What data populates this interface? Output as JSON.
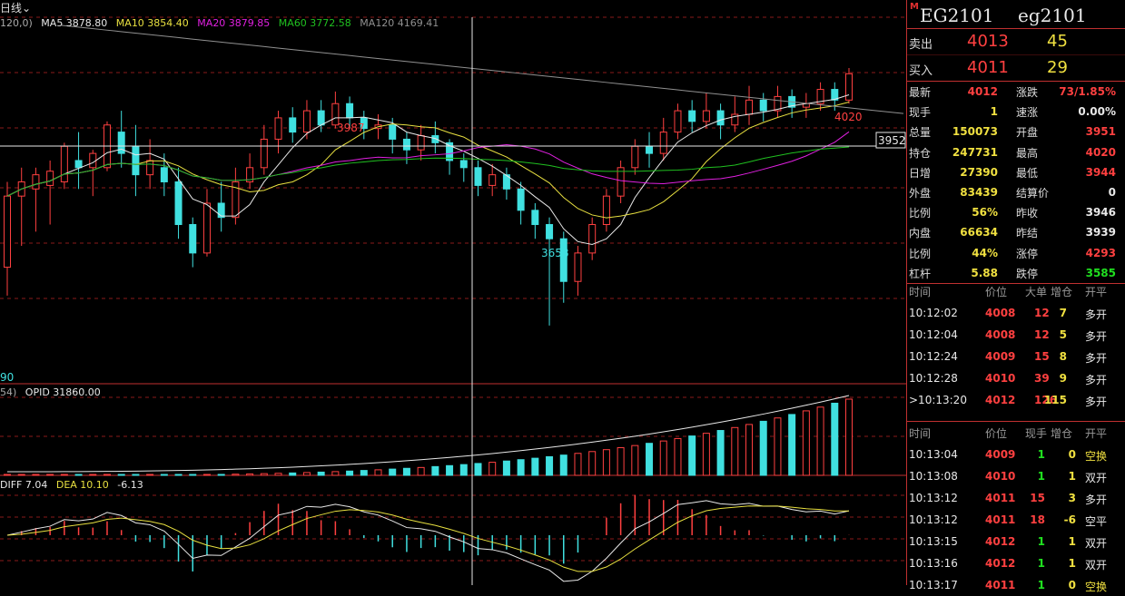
{
  "chart": {
    "period_label": "日线",
    "ma_header": {
      "params": "120,0)",
      "ma5": "MA5 3878.80",
      "ma10": "MA10 3854.40",
      "ma20": "MA20 3879.85",
      "ma60": "MA60 3772.58",
      "ma120": "MA120 4169.41"
    },
    "labels": {
      "high_mark": "3987",
      "low_mark": "3658",
      "latest_mark": "4020",
      "left_low": "90",
      "crosshair_price": "3952"
    },
    "opi_header": {
      "params": "54)",
      "opid": "OPID 31860.00"
    },
    "macd_header": {
      "diff": "DIFF 7.04",
      "dea": "DEA 10.10",
      "macd": "-6.13"
    },
    "colors": {
      "up": "#ff4040",
      "down": "#40e0e0",
      "ma5": "#e8e8e8",
      "ma10": "#e8e040",
      "ma20": "#e020e0",
      "ma60": "#20c020",
      "ma120": "#909090",
      "grid": "#8a1a1a",
      "border": "#c03030"
    }
  },
  "chart_data": {
    "type": "candlestick",
    "candles": [
      [
        3740,
        3840,
        3700,
        3860
      ],
      [
        3840,
        3860,
        3770,
        3880
      ],
      [
        3850,
        3870,
        3790,
        3880
      ],
      [
        3855,
        3875,
        3800,
        3890
      ],
      [
        3860,
        3910,
        3850,
        3915
      ],
      [
        3890,
        3880,
        3850,
        3930
      ],
      [
        3880,
        3900,
        3840,
        3905
      ],
      [
        3880,
        3940,
        3875,
        3945
      ],
      [
        3930,
        3900,
        3880,
        3960
      ],
      [
        3910,
        3870,
        3840,
        3940
      ],
      [
        3870,
        3890,
        3850,
        3920
      ],
      [
        3880,
        3860,
        3840,
        3900
      ],
      [
        3860,
        3800,
        3780,
        3880
      ],
      [
        3800,
        3760,
        3740,
        3810
      ],
      [
        3760,
        3830,
        3755,
        3850
      ],
      [
        3830,
        3810,
        3790,
        3860
      ],
      [
        3810,
        3860,
        3800,
        3880
      ],
      [
        3860,
        3880,
        3850,
        3900
      ],
      [
        3880,
        3920,
        3870,
        3940
      ],
      [
        3920,
        3950,
        3900,
        3960
      ],
      [
        3950,
        3930,
        3915,
        3965
      ],
      [
        3930,
        3960,
        3920,
        3975
      ],
      [
        3960,
        3940,
        3930,
        3975
      ],
      [
        3940,
        3970,
        3935,
        3987
      ],
      [
        3970,
        3950,
        3935,
        3980
      ],
      [
        3950,
        3935,
        3920,
        3960
      ],
      [
        3935,
        3940,
        3920,
        3955
      ],
      [
        3940,
        3920,
        3900,
        3950
      ],
      [
        3920,
        3905,
        3885,
        3930
      ],
      [
        3905,
        3925,
        3890,
        3940
      ],
      [
        3925,
        3915,
        3900,
        3945
      ],
      [
        3915,
        3890,
        3870,
        3920
      ],
      [
        3890,
        3880,
        3860,
        3900
      ],
      [
        3880,
        3855,
        3840,
        3890
      ],
      [
        3855,
        3870,
        3840,
        3885
      ],
      [
        3870,
        3850,
        3835,
        3880
      ],
      [
        3850,
        3820,
        3800,
        3860
      ],
      [
        3820,
        3800,
        3780,
        3830
      ],
      [
        3800,
        3780,
        3658,
        3810
      ],
      [
        3780,
        3720,
        3690,
        3790
      ],
      [
        3720,
        3760,
        3700,
        3770
      ],
      [
        3760,
        3800,
        3750,
        3810
      ],
      [
        3800,
        3840,
        3790,
        3850
      ],
      [
        3840,
        3880,
        3830,
        3890
      ],
      [
        3880,
        3910,
        3870,
        3920
      ],
      [
        3910,
        3900,
        3880,
        3930
      ],
      [
        3900,
        3930,
        3890,
        3950
      ],
      [
        3930,
        3960,
        3920,
        3970
      ],
      [
        3960,
        3945,
        3930,
        3975
      ],
      [
        3945,
        3960,
        3935,
        3985
      ],
      [
        3960,
        3940,
        3920,
        3970
      ],
      [
        3940,
        3955,
        3930,
        3980
      ],
      [
        3955,
        3975,
        3940,
        3995
      ],
      [
        3975,
        3960,
        3945,
        3985
      ],
      [
        3960,
        3980,
        3950,
        3995
      ],
      [
        3980,
        3965,
        3950,
        3990
      ],
      [
        3965,
        3970,
        3950,
        3985
      ],
      [
        3970,
        3990,
        3960,
        4000
      ],
      [
        3990,
        3975,
        3960,
        4000
      ],
      [
        3975,
        4012,
        3970,
        4020
      ]
    ],
    "ohlc_order": "open, close, low, high",
    "price_range": [
      3580,
      4080
    ]
  },
  "panel": {
    "m_mark": "M",
    "code_upper": "EG2101",
    "code_lower": "eg2101",
    "ask": {
      "label": "卖出",
      "price": "4013",
      "volume": "45"
    },
    "bid": {
      "label": "买入",
      "price": "4011",
      "volume": "29"
    },
    "stats": [
      {
        "l1": "最新",
        "v1": "4012",
        "c1": "c-red",
        "l2": "涨跌",
        "v2": "73/1.85%",
        "c2": "c-red"
      },
      {
        "l1": "现手",
        "v1": "1",
        "c1": "c-yel",
        "l2": "速涨",
        "v2": "0.00%",
        "c2": "c-wht"
      },
      {
        "l1": "总量",
        "v1": "150073",
        "c1": "c-yel",
        "l2": "开盘",
        "v2": "3951",
        "c2": "c-red"
      },
      {
        "l1": "持仓",
        "v1": "247731",
        "c1": "c-yel",
        "l2": "最高",
        "v2": "4020",
        "c2": "c-red"
      },
      {
        "l1": "日增",
        "v1": "27390",
        "c1": "c-yel",
        "l2": "最低",
        "v2": "3944",
        "c2": "c-red"
      },
      {
        "l1": "外盘",
        "v1": "83439",
        "c1": "c-yel",
        "l2": "结算价",
        "v2": "0",
        "c2": "c-wht"
      },
      {
        "l1": "比例",
        "v1": "56%",
        "c1": "c-yel",
        "l2": "昨收",
        "v2": "3946",
        "c2": "c-wht"
      },
      {
        "l1": "内盘",
        "v1": "66634",
        "c1": "c-yel",
        "l2": "昨结",
        "v2": "3939",
        "c2": "c-wht"
      },
      {
        "l1": "比例",
        "v1": "44%",
        "c1": "c-yel",
        "l2": "涨停",
        "v2": "4293",
        "c2": "c-red"
      },
      {
        "l1": "杠杆",
        "v1": "5.88",
        "c1": "c-yel",
        "l2": "跌停",
        "v2": "3585",
        "c2": "c-grn"
      }
    ],
    "big_orders_header": [
      "时间",
      "价位",
      "大单",
      "增仓",
      "开平"
    ],
    "big_orders": [
      {
        "time": "10:12:02",
        "price": "4008",
        "big": "12",
        "inc": "7",
        "type": "多开"
      },
      {
        "time": "10:12:04",
        "price": "4008",
        "big": "12",
        "inc": "5",
        "type": "多开"
      },
      {
        "time": "10:12:24",
        "price": "4009",
        "big": "15",
        "inc": "8",
        "type": "多开"
      },
      {
        "time": "10:12:28",
        "price": "4010",
        "big": "39",
        "inc": "9",
        "type": "多开"
      },
      {
        "time": ">10:13:20",
        "price": "4012",
        "big": "126",
        "inc": "115",
        "type": "多开"
      }
    ],
    "ticks_header": [
      "时间",
      "价位",
      "现手",
      "增仓",
      "开平"
    ],
    "ticks": [
      {
        "time": "10:13:04",
        "price": "4009",
        "qty": "1",
        "inc": "0",
        "type": "空换",
        "tc": "c-yel"
      },
      {
        "time": "10:13:08",
        "price": "4010",
        "qty": "1",
        "inc": "1",
        "type": "双开",
        "tc": "c-wht"
      },
      {
        "time": "10:13:12",
        "price": "4011",
        "qty": "15",
        "inc": "3",
        "type": "多开",
        "tc": "c-wht"
      },
      {
        "time": "10:13:12",
        "price": "4011",
        "qty": "18",
        "inc": "-6",
        "type": "空平",
        "tc": "c-wht"
      },
      {
        "time": "10:13:15",
        "price": "4012",
        "qty": "1",
        "inc": "1",
        "type": "双开",
        "tc": "c-wht"
      },
      {
        "time": "10:13:16",
        "price": "4012",
        "qty": "1",
        "inc": "1",
        "type": "双开",
        "tc": "c-wht"
      },
      {
        "time": "10:13:17",
        "price": "4011",
        "qty": "1",
        "inc": "0",
        "type": "空换",
        "tc": "c-yel"
      }
    ]
  }
}
